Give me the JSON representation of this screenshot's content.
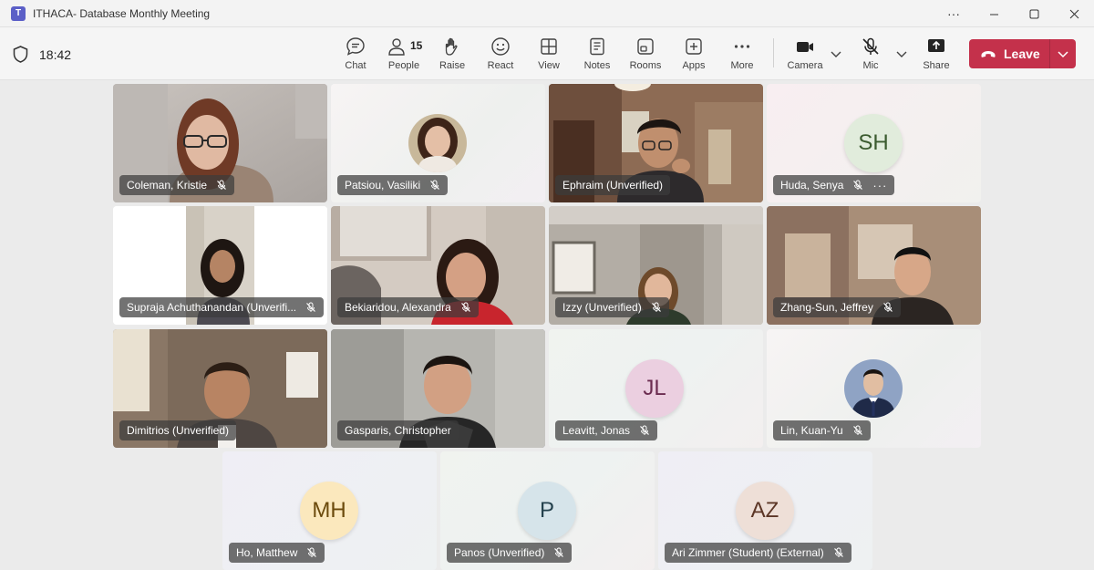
{
  "window": {
    "title": "ITHACA- Database Monthly Meeting",
    "controls": [
      "more-options",
      "minimize",
      "maximize",
      "close"
    ]
  },
  "toolbar": {
    "time": "18:42",
    "chat": "Chat",
    "people": "People",
    "people_count": "15",
    "raise": "Raise",
    "react": "React",
    "view": "View",
    "notes": "Notes",
    "rooms": "Rooms",
    "apps": "Apps",
    "more": "More",
    "camera": "Camera",
    "mic": "Mic",
    "share": "Share",
    "leave": "Leave"
  },
  "colors": {
    "leave_red": "#c4314b",
    "accent": "#6264a7"
  },
  "participants": [
    {
      "name": "Coleman, Kristie",
      "muted": true,
      "kind": "video"
    },
    {
      "name": "Patsiou, Vasiliki",
      "muted": true,
      "kind": "photo"
    },
    {
      "name": "Ephraim (Unverified)",
      "muted": false,
      "kind": "video"
    },
    {
      "name": "Huda, Senya",
      "muted": true,
      "kind": "initials",
      "initials": "SH",
      "more": "···"
    },
    {
      "name": "Supraja Achuthanandan (Unverifi...",
      "muted": true,
      "kind": "video"
    },
    {
      "name": "Bekiaridou, Alexandra",
      "muted": true,
      "kind": "video"
    },
    {
      "name": "Izzy (Unverified)",
      "muted": true,
      "kind": "video"
    },
    {
      "name": "Zhang-Sun, Jeffrey",
      "muted": true,
      "kind": "video"
    },
    {
      "name": "Dimitrios (Unverified)",
      "muted": false,
      "kind": "video"
    },
    {
      "name": "Gasparis, Christopher",
      "muted": false,
      "kind": "video",
      "active": true
    },
    {
      "name": "Leavitt, Jonas",
      "muted": true,
      "kind": "initials",
      "initials": "JL"
    },
    {
      "name": "Lin, Kuan-Yu",
      "muted": true,
      "kind": "photo"
    },
    {
      "name": "Ho, Matthew",
      "muted": true,
      "kind": "initials",
      "initials": "MH"
    },
    {
      "name": "Panos (Unverified)",
      "muted": true,
      "kind": "initials",
      "initials": "P"
    },
    {
      "name": "Ari Zimmer (Student) (External)",
      "muted": true,
      "kind": "initials",
      "initials": "AZ"
    }
  ]
}
